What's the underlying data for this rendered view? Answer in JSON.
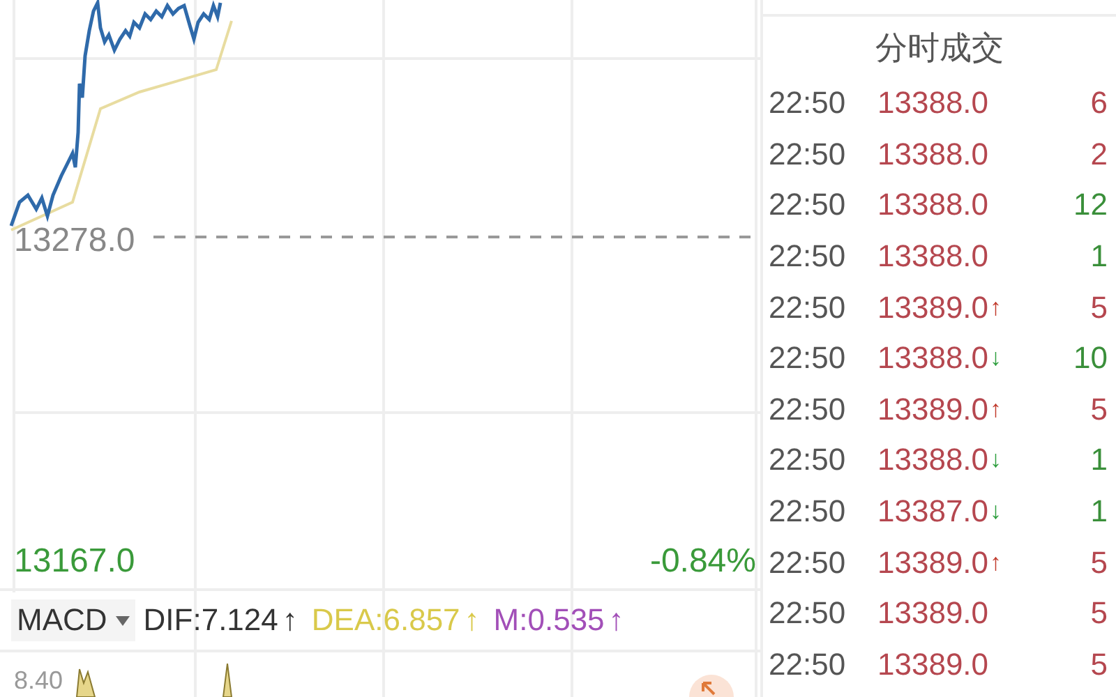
{
  "chart": {
    "reference_price": "13278.0",
    "low_price": "13167.0",
    "change": "-0.84%"
  },
  "indicator_bar": {
    "name": "MACD",
    "values": [
      {
        "label": "DIF:7.124",
        "arrow": "↑",
        "color": "#333333"
      },
      {
        "label": "DEA:6.857",
        "arrow": "↑",
        "color": "#d9c94a"
      },
      {
        "label": "M:0.535",
        "arrow": "↑",
        "color": "#a24fb8"
      }
    ]
  },
  "macd_panel": {
    "max_label": "8.40"
  },
  "trades": {
    "title": "分时成交",
    "rows": [
      {
        "time": "22:50",
        "price": "13388.0",
        "volume": "6",
        "buy": true
      },
      {
        "time": "22:50",
        "price": "13388.0",
        "volume": "2",
        "buy": true
      },
      {
        "time": "22:50",
        "price": "13388.0",
        "volume": "12",
        "buy": false
      },
      {
        "time": "22:50",
        "price": "13388.0",
        "volume": "1",
        "buy": false
      },
      {
        "time": "22:50",
        "price": "13389.0",
        "arrow": "↑",
        "arrow_up": true,
        "volume": "5",
        "buy": true
      },
      {
        "time": "22:50",
        "price": "13388.0",
        "arrow": "↓",
        "arrow_up": false,
        "volume": "10",
        "buy": false
      },
      {
        "time": "22:50",
        "price": "13389.0",
        "arrow": "↑",
        "arrow_up": true,
        "volume": "5",
        "buy": true
      },
      {
        "time": "22:50",
        "price": "13388.0",
        "arrow": "↓",
        "arrow_up": false,
        "volume": "1",
        "buy": false
      },
      {
        "time": "22:50",
        "price": "13387.0",
        "arrow": "↓",
        "arrow_up": false,
        "volume": "1",
        "buy": false
      },
      {
        "time": "22:50",
        "price": "13389.0",
        "arrow": "↑",
        "arrow_up": true,
        "volume": "5",
        "buy": true
      },
      {
        "time": "22:50",
        "price": "13389.0",
        "volume": "5",
        "buy": true
      },
      {
        "time": "22:50",
        "price": "13389.0",
        "volume": "5",
        "buy": true
      }
    ]
  }
}
